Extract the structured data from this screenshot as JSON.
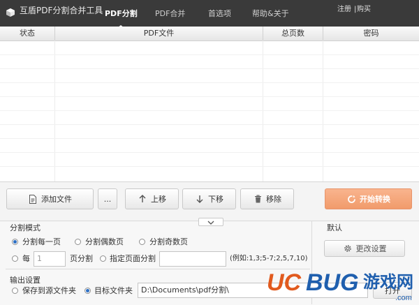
{
  "app": {
    "title": "互盾PDF分割合并工具"
  },
  "tabs": [
    {
      "label": "PDF分割",
      "active": true
    },
    {
      "label": "PDF合并",
      "active": false
    },
    {
      "label": "首选项",
      "active": false
    },
    {
      "label": "帮助&关于",
      "active": false
    }
  ],
  "account": {
    "register": "注册",
    "sep": "|",
    "buy": "购买"
  },
  "table": {
    "columns": [
      "状态",
      "PDF文件",
      "总页数",
      "密码"
    ],
    "rows": []
  },
  "toolbar": {
    "add_file": "添加文件",
    "more": "...",
    "move_up": "上移",
    "move_down": "下移",
    "remove": "移除",
    "start": "开始转换"
  },
  "split": {
    "heading": "分割模式",
    "option_every_page": "分割每一页",
    "option_even": "分割偶数页",
    "option_odd": "分割奇数页",
    "every_label": "每",
    "every_value": "1",
    "pages_label": "页分割",
    "specify_label": "指定页面分割",
    "specify_value": "",
    "example": "(例如:1,3;5-7;2,5,7,10)"
  },
  "output": {
    "heading": "输出设置",
    "option_source": "保存到源文件夹",
    "option_target": "目标文件夹",
    "path": "D:\\Documents\\pdf分割\\",
    "open": "打开"
  },
  "default": {
    "heading": "默认",
    "change": "更改设置"
  },
  "watermark": {
    "text": "UCBUG游戏网",
    "domain": ".com"
  },
  "colors": {
    "accent": "#f19b6b",
    "titlebar": "#3a3a3a",
    "radio": "#2d6fc4"
  },
  "icons": [
    "app-logo-icon",
    "document-icon",
    "arrow-up-icon",
    "arrow-down-icon",
    "trash-icon",
    "refresh-icon",
    "gear-icon",
    "chevron-down-icon"
  ]
}
